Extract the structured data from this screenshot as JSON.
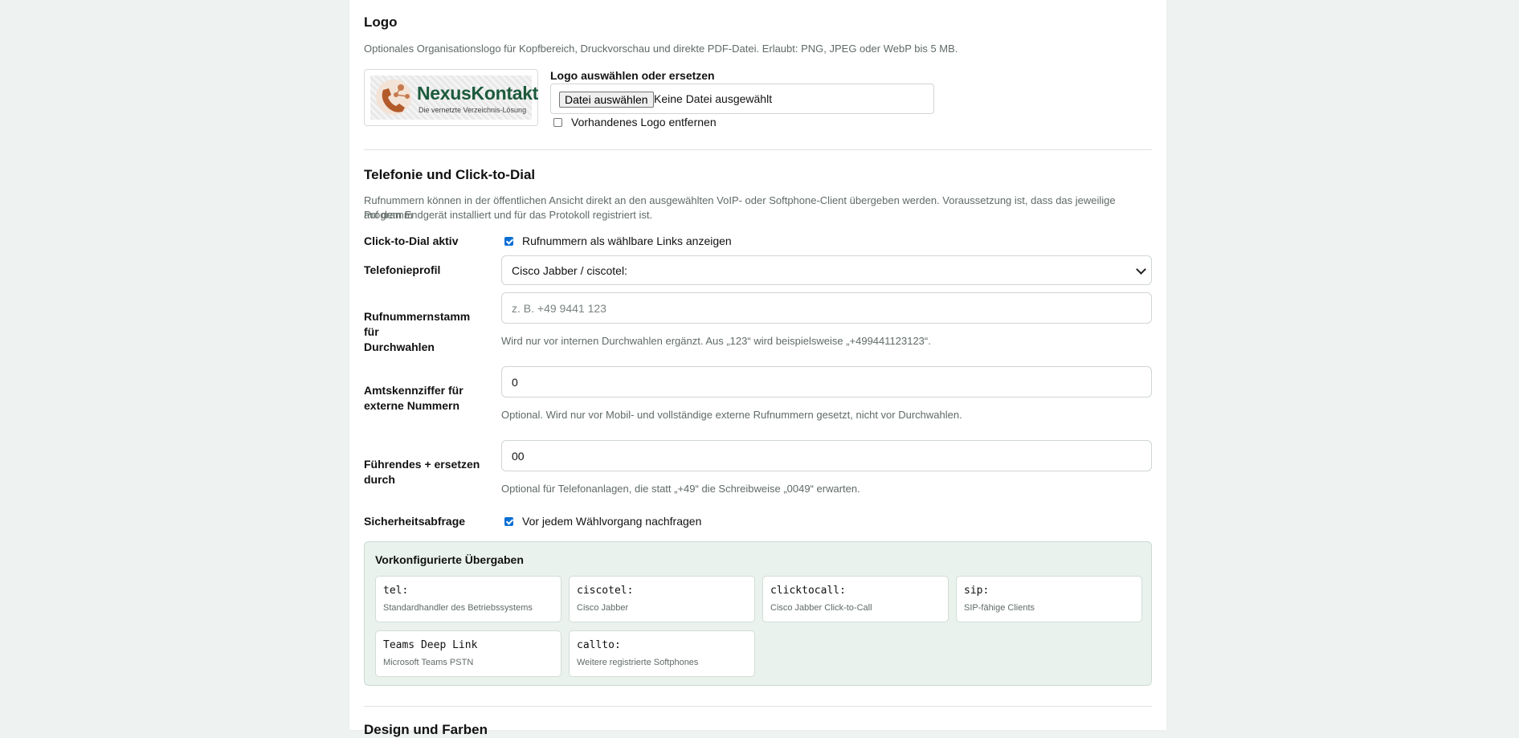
{
  "logo_section": {
    "title": "Logo",
    "description": "Optionales Organisationslogo für Kopfbereich, Druckvorschau und direkte PDF-Datei. Erlaubt: PNG, JPEG oder WebP bis 5 MB.",
    "preview": {
      "brand": "NexusKontakt",
      "tagline": "Die vernetzte Verzeichnis-Lösung"
    },
    "file_label": "Logo auswählen oder ersetzen",
    "file_button": "Datei auswählen",
    "file_status": "Keine Datei ausgewählt",
    "remove_label": "Vorhandenes Logo entfernen",
    "remove_checked": false
  },
  "telephony": {
    "title": "Telefonie und Click-to-Dial",
    "description_line1": "Rufnummern können in der öffentlichen Ansicht direkt an den ausgewählten VoIP- oder Softphone-Client übergeben werden. Voraussetzung ist, dass das jeweilige Programm",
    "description_line2": "auf dem Endgerät installiert und für das Protokoll registriert ist.",
    "click_to_dial": {
      "label": "Click-to-Dial aktiv",
      "checkbox_label": "Rufnummern als wählbare Links anzeigen",
      "checked": true
    },
    "profile": {
      "label": "Telefonieprofil",
      "value": "Cisco Jabber / ciscotel:"
    },
    "prefix": {
      "label_line1": "Rufnummernstamm für",
      "label_line2": "Durchwahlen",
      "value": "",
      "placeholder": "z. B. +49 9441 123",
      "help": "Wird nur vor internen Durchwahlen ergänzt. Aus „123“ wird beispielsweise „+499441123123“."
    },
    "trunk": {
      "label_line1": "Amtskennziffer für",
      "label_line2": "externe Nummern",
      "value": "0",
      "help": "Optional. Wird nur vor Mobil- und vollständige externe Rufnummern gesetzt, nicht vor Durchwahlen."
    },
    "plus": {
      "label_line1": "Führendes + ersetzen",
      "label_line2": "durch",
      "value": "00",
      "help": "Optional für Telefonanlagen, die statt „+49“ die Schreibweise „0049“ erwarten."
    },
    "confirm": {
      "label": "Sicherheitsabfrage",
      "checkbox_label": "Vor jedem Wählvorgang nachfragen",
      "checked": true
    },
    "presets": {
      "title": "Vorkonfigurierte Übergaben",
      "items": [
        {
          "code": "tel:",
          "desc": "Standardhandler des Betriebssystems"
        },
        {
          "code": "ciscotel:",
          "desc": "Cisco Jabber"
        },
        {
          "code": "clicktocall:",
          "desc": "Cisco Jabber Click-to-Call"
        },
        {
          "code": "sip:",
          "desc": "SIP-fähige Clients"
        },
        {
          "code": "Teams Deep Link",
          "desc": "Microsoft Teams PSTN"
        },
        {
          "code": "callto:",
          "desc": "Weitere registrierte Softphones"
        }
      ]
    }
  },
  "next_section": {
    "title": "Design und Farben"
  },
  "colors": {
    "accent": "#0b6fd4",
    "brand_green": "#1c5a3c",
    "preset_bg": "#e9f2ed"
  }
}
